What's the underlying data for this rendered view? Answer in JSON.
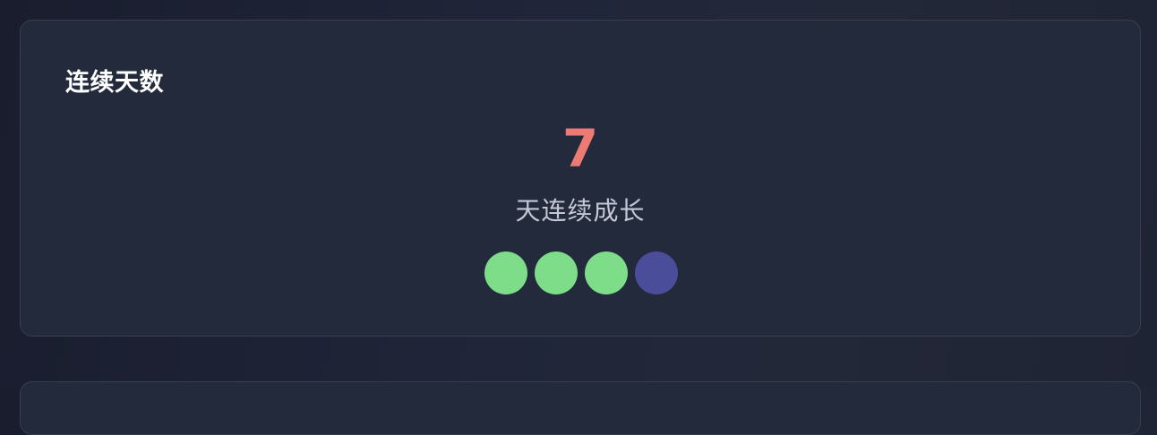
{
  "streak_card": {
    "title": "连续天数",
    "count": "7",
    "caption": "天连续成长",
    "days": [
      {
        "status": "done"
      },
      {
        "status": "done"
      },
      {
        "status": "done"
      },
      {
        "status": "current"
      }
    ]
  },
  "colors": {
    "count": "#ee7b73",
    "done_dot": "#7ddd89",
    "current_dot": "#4a4e9a",
    "card_bg": "#222a3b"
  }
}
